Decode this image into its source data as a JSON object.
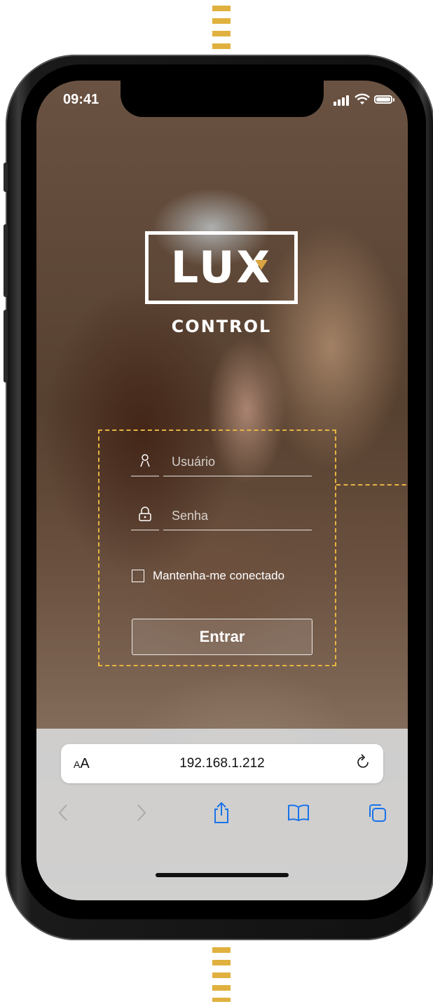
{
  "status_bar": {
    "time": "09:41"
  },
  "brand": {
    "logo_text": "LUX",
    "subtitle": "CONTROL"
  },
  "login": {
    "username": {
      "placeholder": "Usuário",
      "value": "",
      "icon": "user-icon"
    },
    "password": {
      "placeholder": "Senha",
      "value": "",
      "icon": "lock-icon"
    },
    "remember_me": {
      "label": "Mantenha-me conectado",
      "checked": false
    },
    "submit_label": "Entrar"
  },
  "browser": {
    "text_size_label_small": "A",
    "text_size_label_large": "A",
    "url": "192.168.1.212",
    "icons": [
      "reload-icon",
      "back-icon",
      "forward-icon",
      "share-icon",
      "bookmarks-icon",
      "tabs-icon"
    ]
  },
  "colors": {
    "accent": "#e6b442",
    "logo_accent": "#d9a441",
    "browser_icon": "#1a73e8"
  }
}
